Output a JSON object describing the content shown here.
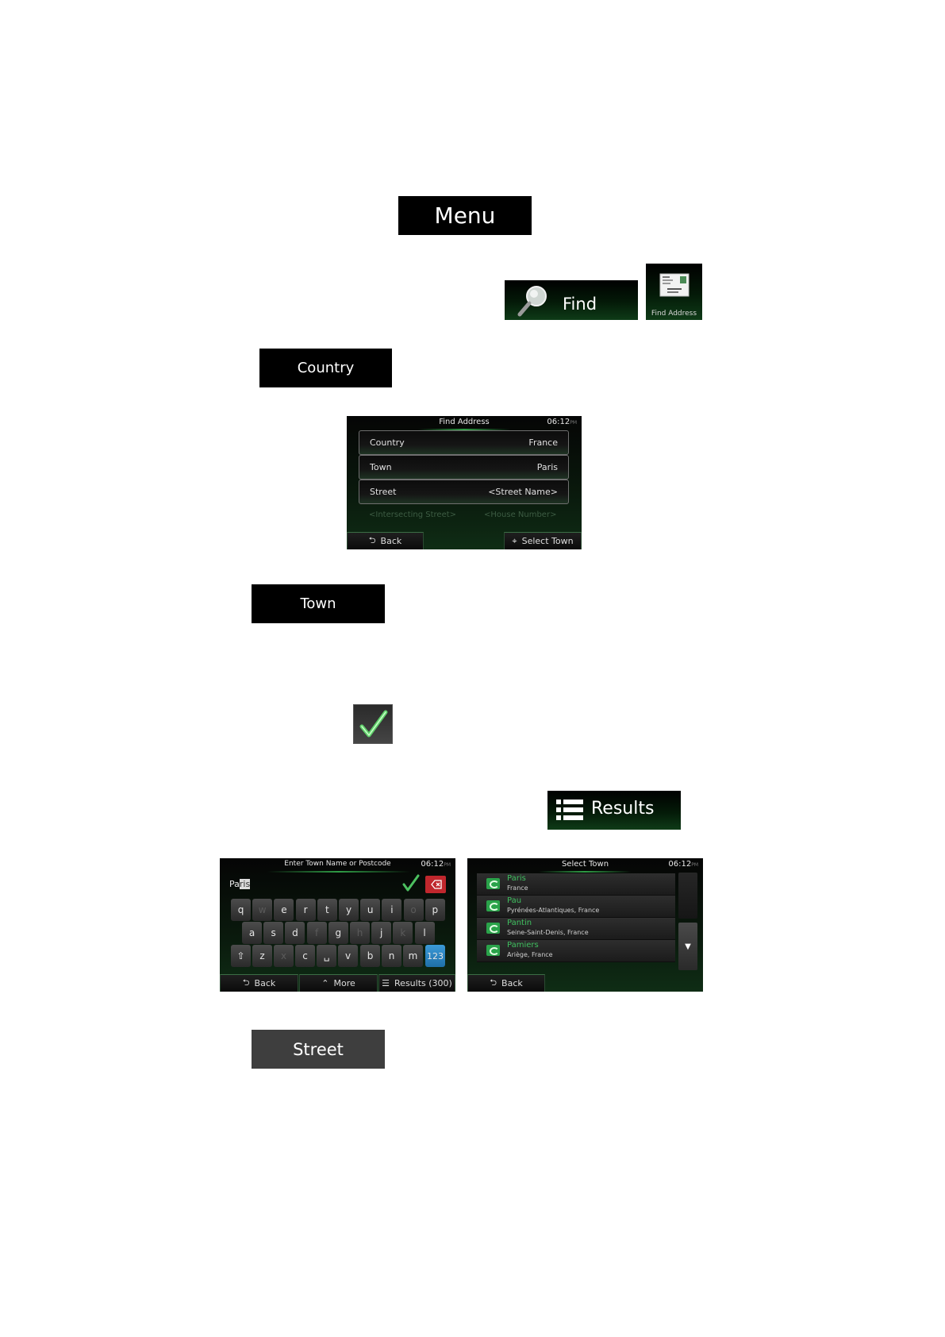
{
  "menu_button": {
    "label": "Menu"
  },
  "find_button": {
    "label": "Find",
    "icon": "magnifier-icon"
  },
  "find_address_tile": {
    "label": "Find Address",
    "icon": "address-card-icon"
  },
  "country_button": {
    "label": "Country"
  },
  "find_address_screen": {
    "title": "Find Address",
    "time": "06:12",
    "time_suffix": "PM",
    "fields": [
      {
        "label": "Country",
        "value": "France"
      },
      {
        "label": "Town",
        "value": "Paris"
      },
      {
        "label": "Street",
        "value": "<Street Name>"
      }
    ],
    "disabled_fields": [
      "<Intersecting Street>",
      "<House Number>"
    ],
    "back_label": "Back",
    "select_label": "Select Town"
  },
  "town_button": {
    "label": "Town"
  },
  "checkmark_button": {
    "icon": "checkmark-icon"
  },
  "results_button": {
    "label": "Results",
    "icon": "list-icon"
  },
  "keyboard_screen": {
    "title": "Enter Town Name or Postcode",
    "time": "06:12",
    "time_suffix": "PM",
    "input_typed": "Pa",
    "input_suggest": "ris",
    "rows": [
      [
        "q",
        "w",
        "e",
        "r",
        "t",
        "y",
        "u",
        "i",
        "o",
        "p"
      ],
      [
        "a",
        "s",
        "d",
        "f",
        "g",
        "h",
        "j",
        "k",
        "l"
      ],
      [
        "z",
        "x",
        "c",
        "v",
        "b",
        "n",
        "m"
      ]
    ],
    "disabled_keys": [
      "w",
      "o",
      "f",
      "h",
      "k",
      "x"
    ],
    "numeric_key": "123",
    "back_label": "Back",
    "more_label": "More",
    "results_label": "Results (300)"
  },
  "select_town_screen": {
    "title": "Select Town",
    "time": "06:12",
    "time_suffix": "PM",
    "items": [
      {
        "name": "Paris",
        "region": "France"
      },
      {
        "name": "Pau",
        "region": "Pyrénées-Atlantiques, France"
      },
      {
        "name": "Pantin",
        "region": "Seine-Saint-Denis, France"
      },
      {
        "name": "Pamiers",
        "region": "Ariège, France"
      }
    ],
    "back_label": "Back"
  },
  "street_button": {
    "label": "Street"
  },
  "colors": {
    "accent_green": "#2aa34a",
    "button_black": "#000000",
    "street_gray": "#3e3e3e",
    "numeric_key_blue": "#2a86c8",
    "delete_red": "#c0272d"
  }
}
